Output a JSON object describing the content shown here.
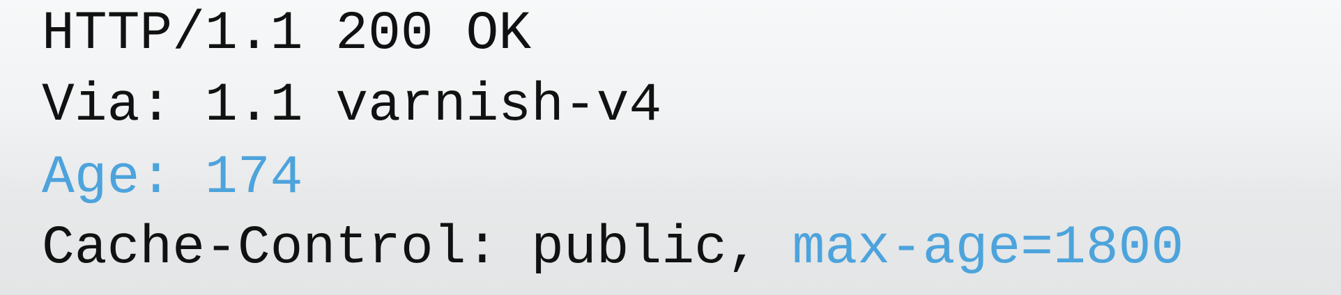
{
  "headers": {
    "status_line": "HTTP/1.1 200 OK",
    "via": "Via: 1.1 varnish-v4",
    "age": "Age: 174",
    "cache_control_prefix": "Cache-Control: public, ",
    "cache_control_max_age": "max-age=1800"
  },
  "colors": {
    "text": "#111111",
    "accent": "#4da3dc",
    "background": "#f0f2f3"
  }
}
